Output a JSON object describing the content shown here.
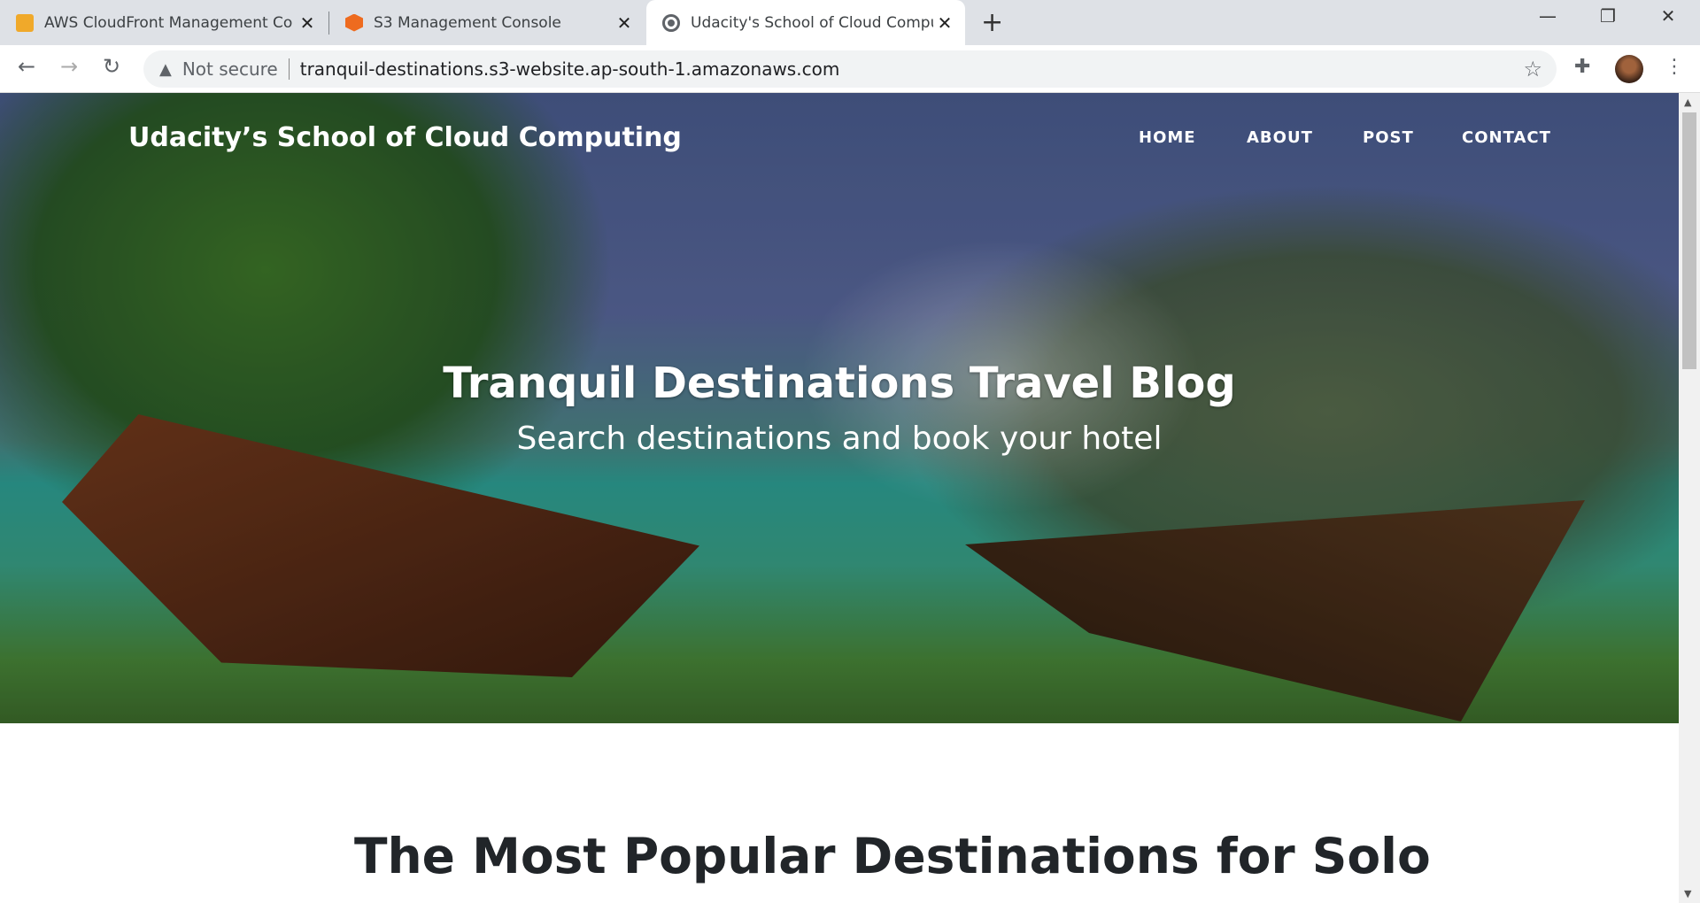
{
  "browser": {
    "tabs": [
      {
        "title": "AWS CloudFront Management Co",
        "icon": "aws-cube-icon",
        "active": false
      },
      {
        "title": "S3 Management Console",
        "icon": "s3-cube-icon",
        "active": false
      },
      {
        "title": "Udacity's School of Cloud Computing",
        "icon": "globe-icon",
        "active": true
      }
    ],
    "security": "Not secure",
    "url": "tranquil-destinations.s3-website.ap-south-1.amazonaws.com"
  },
  "site": {
    "brand": "Udacity’s School of Cloud Computing",
    "nav": [
      "HOME",
      "ABOUT",
      "POST",
      "CONTACT"
    ],
    "hero_title": "Tranquil Destinations Travel Blog",
    "hero_subtitle": "Search destinations and book your hotel",
    "post_heading": "The Most Popular Destinations for Solo"
  }
}
